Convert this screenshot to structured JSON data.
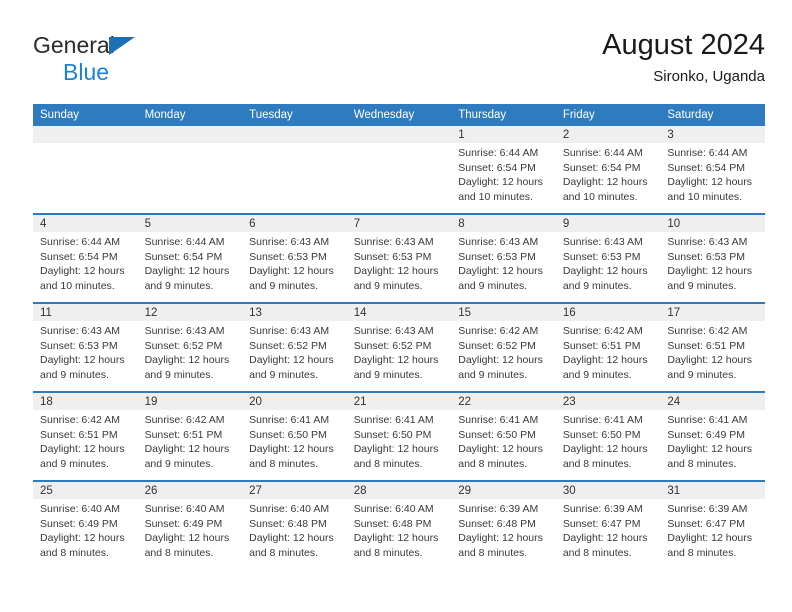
{
  "brand": {
    "line1": "General",
    "line2": "Blue",
    "triangle_color": "#1f6fb5",
    "line2_color": "#1c83d4"
  },
  "header": {
    "title": "August 2024",
    "subtitle": "Sironko, Uganda"
  },
  "theme": {
    "header_bg": "#2e7bbf",
    "header_text": "#ffffff",
    "daynum_band_bg": "#efefef",
    "cell_bg": "#ffffff",
    "row_border": "#2e7bbf"
  },
  "weekday_headers": [
    "Sunday",
    "Monday",
    "Tuesday",
    "Wednesday",
    "Thursday",
    "Friday",
    "Saturday"
  ],
  "labels": {
    "sunrise_prefix": "Sunrise:",
    "sunset_prefix": "Sunset:",
    "daylight_prefix": "Daylight:"
  },
  "weeks": [
    [
      {
        "day": "",
        "l1": "",
        "l2": "",
        "l3": "",
        "l4": ""
      },
      {
        "day": "",
        "l1": "",
        "l2": "",
        "l3": "",
        "l4": ""
      },
      {
        "day": "",
        "l1": "",
        "l2": "",
        "l3": "",
        "l4": ""
      },
      {
        "day": "",
        "l1": "",
        "l2": "",
        "l3": "",
        "l4": ""
      },
      {
        "day": "1",
        "l1": "Sunrise: 6:44 AM",
        "l2": "Sunset: 6:54 PM",
        "l3": "Daylight: 12 hours",
        "l4": "and 10 minutes."
      },
      {
        "day": "2",
        "l1": "Sunrise: 6:44 AM",
        "l2": "Sunset: 6:54 PM",
        "l3": "Daylight: 12 hours",
        "l4": "and 10 minutes."
      },
      {
        "day": "3",
        "l1": "Sunrise: 6:44 AM",
        "l2": "Sunset: 6:54 PM",
        "l3": "Daylight: 12 hours",
        "l4": "and 10 minutes."
      }
    ],
    [
      {
        "day": "4",
        "l1": "Sunrise: 6:44 AM",
        "l2": "Sunset: 6:54 PM",
        "l3": "Daylight: 12 hours",
        "l4": "and 10 minutes."
      },
      {
        "day": "5",
        "l1": "Sunrise: 6:44 AM",
        "l2": "Sunset: 6:54 PM",
        "l3": "Daylight: 12 hours",
        "l4": "and 9 minutes."
      },
      {
        "day": "6",
        "l1": "Sunrise: 6:43 AM",
        "l2": "Sunset: 6:53 PM",
        "l3": "Daylight: 12 hours",
        "l4": "and 9 minutes."
      },
      {
        "day": "7",
        "l1": "Sunrise: 6:43 AM",
        "l2": "Sunset: 6:53 PM",
        "l3": "Daylight: 12 hours",
        "l4": "and 9 minutes."
      },
      {
        "day": "8",
        "l1": "Sunrise: 6:43 AM",
        "l2": "Sunset: 6:53 PM",
        "l3": "Daylight: 12 hours",
        "l4": "and 9 minutes."
      },
      {
        "day": "9",
        "l1": "Sunrise: 6:43 AM",
        "l2": "Sunset: 6:53 PM",
        "l3": "Daylight: 12 hours",
        "l4": "and 9 minutes."
      },
      {
        "day": "10",
        "l1": "Sunrise: 6:43 AM",
        "l2": "Sunset: 6:53 PM",
        "l3": "Daylight: 12 hours",
        "l4": "and 9 minutes."
      }
    ],
    [
      {
        "day": "11",
        "l1": "Sunrise: 6:43 AM",
        "l2": "Sunset: 6:53 PM",
        "l3": "Daylight: 12 hours",
        "l4": "and 9 minutes."
      },
      {
        "day": "12",
        "l1": "Sunrise: 6:43 AM",
        "l2": "Sunset: 6:52 PM",
        "l3": "Daylight: 12 hours",
        "l4": "and 9 minutes."
      },
      {
        "day": "13",
        "l1": "Sunrise: 6:43 AM",
        "l2": "Sunset: 6:52 PM",
        "l3": "Daylight: 12 hours",
        "l4": "and 9 minutes."
      },
      {
        "day": "14",
        "l1": "Sunrise: 6:43 AM",
        "l2": "Sunset: 6:52 PM",
        "l3": "Daylight: 12 hours",
        "l4": "and 9 minutes."
      },
      {
        "day": "15",
        "l1": "Sunrise: 6:42 AM",
        "l2": "Sunset: 6:52 PM",
        "l3": "Daylight: 12 hours",
        "l4": "and 9 minutes."
      },
      {
        "day": "16",
        "l1": "Sunrise: 6:42 AM",
        "l2": "Sunset: 6:51 PM",
        "l3": "Daylight: 12 hours",
        "l4": "and 9 minutes."
      },
      {
        "day": "17",
        "l1": "Sunrise: 6:42 AM",
        "l2": "Sunset: 6:51 PM",
        "l3": "Daylight: 12 hours",
        "l4": "and 9 minutes."
      }
    ],
    [
      {
        "day": "18",
        "l1": "Sunrise: 6:42 AM",
        "l2": "Sunset: 6:51 PM",
        "l3": "Daylight: 12 hours",
        "l4": "and 9 minutes."
      },
      {
        "day": "19",
        "l1": "Sunrise: 6:42 AM",
        "l2": "Sunset: 6:51 PM",
        "l3": "Daylight: 12 hours",
        "l4": "and 9 minutes."
      },
      {
        "day": "20",
        "l1": "Sunrise: 6:41 AM",
        "l2": "Sunset: 6:50 PM",
        "l3": "Daylight: 12 hours",
        "l4": "and 8 minutes."
      },
      {
        "day": "21",
        "l1": "Sunrise: 6:41 AM",
        "l2": "Sunset: 6:50 PM",
        "l3": "Daylight: 12 hours",
        "l4": "and 8 minutes."
      },
      {
        "day": "22",
        "l1": "Sunrise: 6:41 AM",
        "l2": "Sunset: 6:50 PM",
        "l3": "Daylight: 12 hours",
        "l4": "and 8 minutes."
      },
      {
        "day": "23",
        "l1": "Sunrise: 6:41 AM",
        "l2": "Sunset: 6:50 PM",
        "l3": "Daylight: 12 hours",
        "l4": "and 8 minutes."
      },
      {
        "day": "24",
        "l1": "Sunrise: 6:41 AM",
        "l2": "Sunset: 6:49 PM",
        "l3": "Daylight: 12 hours",
        "l4": "and 8 minutes."
      }
    ],
    [
      {
        "day": "25",
        "l1": "Sunrise: 6:40 AM",
        "l2": "Sunset: 6:49 PM",
        "l3": "Daylight: 12 hours",
        "l4": "and 8 minutes."
      },
      {
        "day": "26",
        "l1": "Sunrise: 6:40 AM",
        "l2": "Sunset: 6:49 PM",
        "l3": "Daylight: 12 hours",
        "l4": "and 8 minutes."
      },
      {
        "day": "27",
        "l1": "Sunrise: 6:40 AM",
        "l2": "Sunset: 6:48 PM",
        "l3": "Daylight: 12 hours",
        "l4": "and 8 minutes."
      },
      {
        "day": "28",
        "l1": "Sunrise: 6:40 AM",
        "l2": "Sunset: 6:48 PM",
        "l3": "Daylight: 12 hours",
        "l4": "and 8 minutes."
      },
      {
        "day": "29",
        "l1": "Sunrise: 6:39 AM",
        "l2": "Sunset: 6:48 PM",
        "l3": "Daylight: 12 hours",
        "l4": "and 8 minutes."
      },
      {
        "day": "30",
        "l1": "Sunrise: 6:39 AM",
        "l2": "Sunset: 6:47 PM",
        "l3": "Daylight: 12 hours",
        "l4": "and 8 minutes."
      },
      {
        "day": "31",
        "l1": "Sunrise: 6:39 AM",
        "l2": "Sunset: 6:47 PM",
        "l3": "Daylight: 12 hours",
        "l4": "and 8 minutes."
      }
    ]
  ]
}
